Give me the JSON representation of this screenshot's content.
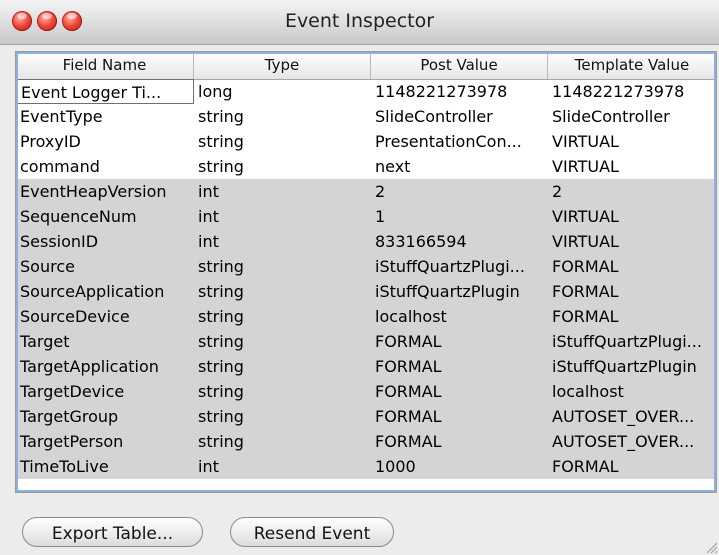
{
  "window": {
    "title": "Event Inspector"
  },
  "table": {
    "columns": [
      "Field Name",
      "Type",
      "Post Value",
      "Template Value"
    ],
    "rows": [
      [
        "Event Logger Ti...",
        "long",
        "1148221273978",
        "1148221273978"
      ],
      [
        "EventType",
        "string",
        "SlideController",
        "SlideController"
      ],
      [
        "ProxyID",
        "string",
        "PresentationCon...",
        "VIRTUAL"
      ],
      [
        "command",
        "string",
        "next",
        "VIRTUAL"
      ],
      [
        "EventHeapVersion",
        "int",
        "2",
        "2"
      ],
      [
        "SequenceNum",
        "int",
        "1",
        "VIRTUAL"
      ],
      [
        "SessionID",
        "int",
        "833166594",
        "VIRTUAL"
      ],
      [
        "Source",
        "string",
        "iStuffQuartzPlugi...",
        "FORMAL"
      ],
      [
        "SourceApplication",
        "string",
        "iStuffQuartzPlugin",
        "FORMAL"
      ],
      [
        "SourceDevice",
        "string",
        "localhost",
        "FORMAL"
      ],
      [
        "Target",
        "string",
        "FORMAL",
        "iStuffQuartzPlugi..."
      ],
      [
        "TargetApplication",
        "string",
        "FORMAL",
        "iStuffQuartzPlugin"
      ],
      [
        "TargetDevice",
        "string",
        "FORMAL",
        "localhost"
      ],
      [
        "TargetGroup",
        "string",
        "FORMAL",
        "AUTOSET_OVER..."
      ],
      [
        "TargetPerson",
        "string",
        "FORMAL",
        "AUTOSET_OVER..."
      ],
      [
        "TimeToLive",
        "int",
        "1000",
        "FORMAL"
      ]
    ],
    "selected_rows": [
      4,
      5,
      6,
      7,
      8,
      9,
      10,
      11,
      12,
      13,
      14,
      15
    ],
    "editing_cell": [
      0,
      0
    ]
  },
  "buttons": {
    "export": "Export Table...",
    "resend": "Resend Event"
  },
  "colors": {
    "selection": "#d4d4d4",
    "focus_ring": "#8eb1dc",
    "close": "#ef4a3a"
  },
  "icons": [
    "close-icon",
    "minimize-icon",
    "zoom-icon",
    "resize-grip-icon"
  ]
}
